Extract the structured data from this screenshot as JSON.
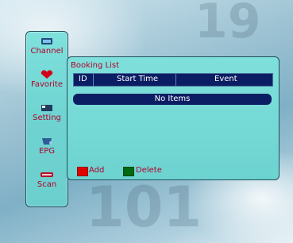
{
  "sidebar": {
    "items": [
      {
        "label": "Channel",
        "icon": "channel-icon"
      },
      {
        "label": "Favorite",
        "icon": "heart-icon"
      },
      {
        "label": "Setting",
        "icon": "setting-icon"
      },
      {
        "label": "EPG",
        "icon": "epg-icon"
      },
      {
        "label": "Scan",
        "icon": "scan-icon"
      }
    ]
  },
  "panel": {
    "title": "Booking List",
    "columns": [
      "ID",
      "Start Time",
      "Event"
    ],
    "empty_text": "No Items"
  },
  "legend": {
    "add": {
      "label": "Add",
      "color": "#e00000"
    },
    "delete": {
      "label": "Delete",
      "color": "#006a12"
    }
  },
  "colors": {
    "accent_text": "#b0002a",
    "header_bg": "#0b1e63",
    "panel_bg": "#6dd3d0"
  }
}
